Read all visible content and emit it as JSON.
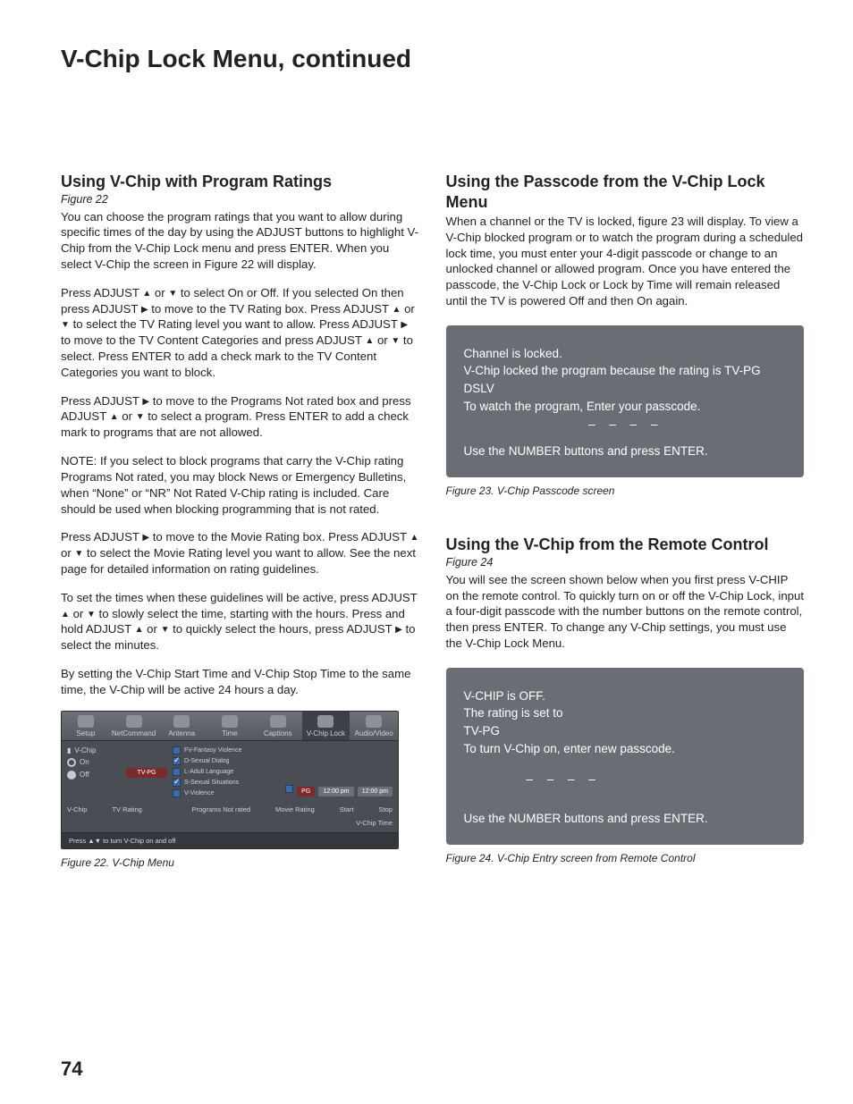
{
  "pageTitle": "V-Chip Lock Menu, continued",
  "pageNumber": "74",
  "left": {
    "h1": "Using V-Chip with Program Ratings",
    "figRef": "Figure 22",
    "p1": "You can choose the program ratings that you want to allow during specific times of the day by using the ADJUST buttons to highlight V-Chip from the V-Chip Lock menu and press ENTER.  When you select V-Chip the screen in Figure 22 will display.",
    "p2a": "Press ADJUST ",
    "p2b": " or ",
    "p2c": " to select On or Off.  If you selected On then press ADJUST ",
    "p2d": " to move to the TV Rating box.  Press ADJUST ",
    "p2e": " or ",
    "p2f": " to select the TV Rating level you want to allow.  Press ADJUST ",
    "p2g": " to move to the TV Content Categories and press ADJUST ",
    "p2h": " or  ",
    "p2i": " to select.  Press ENTER to add a check mark to the TV Content Categories you want to block.",
    "p3a": "Press ADJUST ",
    "p3b": " to move to the Programs Not rated box and press ADJUST ",
    "p3c": " or  ",
    "p3d": " to select a program.  Press ENTER to add a check mark to programs that are not allowed.",
    "p4": "NOTE:  If you select to block programs that carry the V-Chip rating  Programs Not rated, you may block News or Emergency Bulletins, when “None” or “NR” Not Rated V-Chip rating is included.  Care should be used when blocking programming that is not rated.",
    "p5a": "Press ADJUST ",
    "p5b": " to move to the Movie Rating box.  Press ADJUST ",
    "p5c": " or ",
    "p5d": " to select the Movie Rating level you want to allow.  See the next page for detailed information on rating guidelines.",
    "p6a": "To set the times when these guidelines will be active, press ADJUST ",
    "p6b": " or  ",
    "p6c": " to slowly select the time, starting with the hours.  Press and hold ADJUST ",
    "p6d": " or ",
    "p6e": " to quickly select the hours, press ADJUST ",
    "p6f": " to select the minutes.",
    "p7": "By setting the V-Chip Start Time and V-Chip Stop Time to the same time, the V-Chip will be active 24 hours a day.",
    "figCaption": "Figure 22. V-Chip Menu",
    "menu": {
      "tabs": [
        "Setup",
        "NetCommand",
        "Antenna",
        "Time",
        "Captions",
        "V-Chip Lock",
        "Audio/Video"
      ],
      "sideHeader": "V-Chip",
      "on": "On",
      "off": "Off",
      "tvRatingLabel": "TV Rating",
      "tvRatingValue": "TV-PG",
      "checks": [
        "FV-Fantasy Violence",
        "D-Sexual Dialog",
        "L-Adult Language",
        "S-Sexual Situations",
        "V-Violence"
      ],
      "col1": "Programs Not rated",
      "col2": "Movie Rating",
      "movieRatingValue": "PG",
      "start": "Start",
      "stop": "Stop",
      "time1": "12:00 pm",
      "time2": "12:00 pm",
      "vchipTime": "V-Chip Time",
      "vchipLabel": "V-Chip",
      "hint": "Press ▲▼ to turn V-Chip on and off"
    }
  },
  "right": {
    "h1": "Using the Passcode from the V-Chip Lock Menu",
    "p1": "When a channel or the TV is locked, figure 23 will display. To view a V-Chip blocked program or to watch the program during a scheduled lock time, you must enter your 4-digit passcode or change to an unlocked channel or allowed program.  Once you have entered the passcode, the V-Chip Lock or Lock by Time will remain released until the TV is powered Off and then On again.",
    "osd1": {
      "l1": "Channel is locked.",
      "l2": "V-Chip locked the program because the rating is TV-PG DSLV",
      "l3": "To watch the program, Enter your passcode.",
      "dashes": "– – – –",
      "l4": "Use the NUMBER buttons and press ENTER."
    },
    "figCaption1": "Figure 23. V-Chip Passcode screen",
    "h2": "Using the V-Chip from the Remote Control",
    "figRef2": "Figure 24",
    "p2": "You will see the screen shown below when you first press V-CHIP on the remote control.  To quickly turn on or off the V-Chip Lock, input a four-digit passcode with the number buttons on the remote control, then press ENTER.  To change any V-Chip settings, you must use the V-Chip Lock Menu.",
    "osd2": {
      "l1": "V-CHIP is OFF.",
      "l2": "The rating is set to",
      "l3": "TV-PG",
      "l4": "To turn V-Chip on, enter new passcode.",
      "dashes": "– – – –",
      "l5": "Use the NUMBER buttons and press ENTER."
    },
    "figCaption2": "Figure 24. V-Chip Entry screen from Remote Control"
  }
}
